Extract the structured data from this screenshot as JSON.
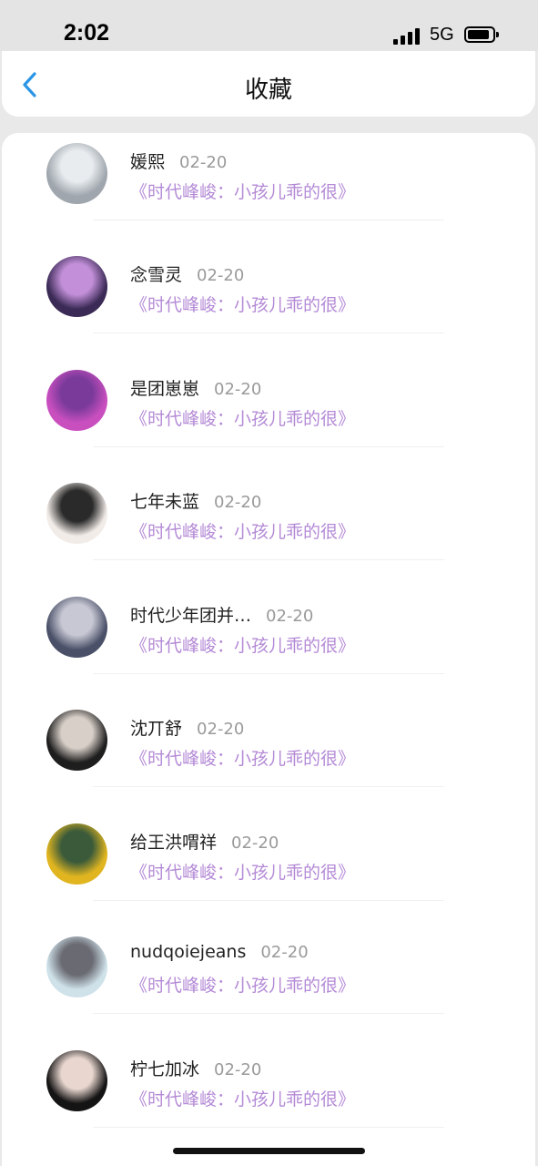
{
  "status": {
    "time": "2:02",
    "network": "5G"
  },
  "header": {
    "title": "收藏"
  },
  "items": [
    {
      "name": "媛熙",
      "date": "02-20",
      "title": "《时代峰峻：小孩儿乖的很》",
      "avatar_colors": [
        "#9fa6ad",
        "#e8ecef"
      ]
    },
    {
      "name": "念雪灵",
      "date": "02-20",
      "title": "《时代峰峻：小孩儿乖的很》",
      "avatar_colors": [
        "#3a2a55",
        "#c28fd8"
      ]
    },
    {
      "name": "是团崽崽",
      "date": "02-20",
      "title": "《时代峰峻：小孩儿乖的很》",
      "avatar_colors": [
        "#c94fbf",
        "#7a3a9a"
      ]
    },
    {
      "name": "七年未蓝",
      "date": "02-20",
      "title": "《时代峰峻：小孩儿乖的很》",
      "avatar_colors": [
        "#f2ece8",
        "#2a2a2a"
      ]
    },
    {
      "name": "时代少年团并…",
      "date": "02-20",
      "title": "《时代峰峻：小孩儿乖的很》",
      "avatar_colors": [
        "#4a5068",
        "#c8c8d4"
      ]
    },
    {
      "name": "沈丌舒",
      "date": "02-20",
      "title": "《时代峰峻：小孩儿乖的很》",
      "avatar_colors": [
        "#1e1e1e",
        "#d8cfc8"
      ]
    },
    {
      "name": "给王洪喟祥",
      "date": "02-20",
      "title": "《时代峰峻：小孩儿乖的很》",
      "avatar_colors": [
        "#e0b520",
        "#3a5a3a"
      ]
    },
    {
      "name": "nudqoiejeans",
      "date": "02-20",
      "title": "《时代峰峻：小孩儿乖的很》",
      "avatar_colors": [
        "#cfe2ea",
        "#6a6a72"
      ]
    },
    {
      "name": "柠七加冰",
      "date": "02-20",
      "title": "《时代峰峻：小孩儿乖的很》",
      "avatar_colors": [
        "#141414",
        "#e8d6cf"
      ]
    }
  ]
}
